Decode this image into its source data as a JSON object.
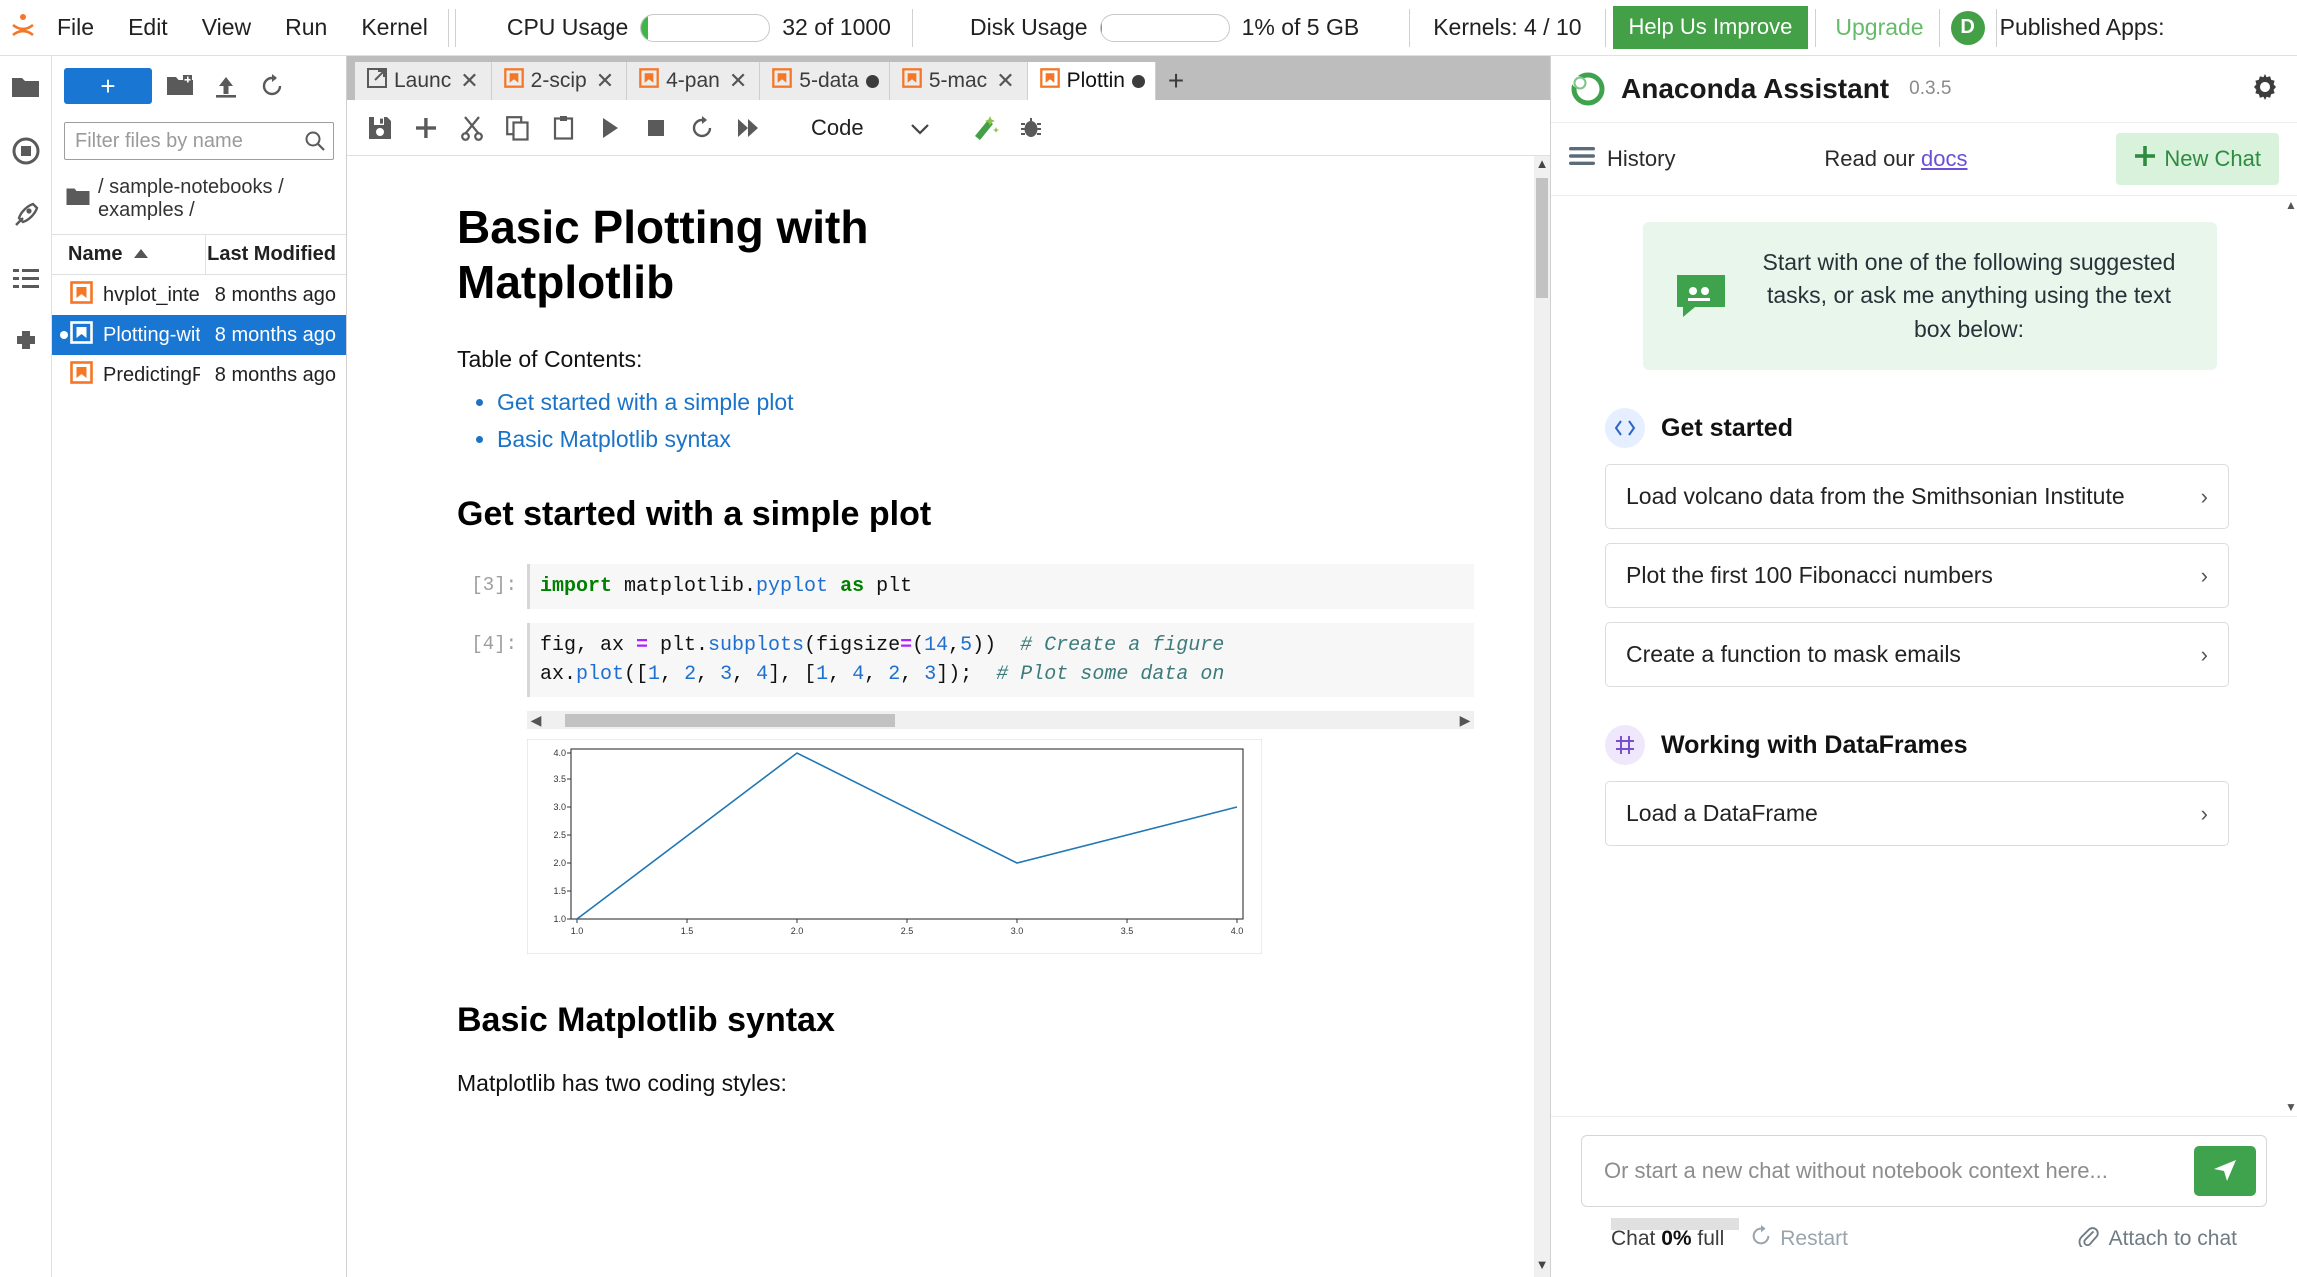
{
  "topbar": {
    "menus": [
      "File",
      "Edit",
      "View",
      "Run",
      "Kernel"
    ],
    "cpu_label": "CPU Usage",
    "cpu_value": "32 of 1000",
    "cpu_percent": 4,
    "disk_label": "Disk Usage",
    "disk_value": "1% of 5 GB",
    "disk_percent": 1,
    "kernels": "Kernels: 4 / 10",
    "help_button": "Help Us Improve",
    "upgrade": "Upgrade",
    "avatar": "D",
    "published_apps": "Published Apps:",
    "accent_green": "#43a047",
    "accent_blue": "#1976d2"
  },
  "filebrowser": {
    "new_label": "+",
    "filter_placeholder": "Filter files by name",
    "breadcrumb": "/ sample-notebooks / examples /",
    "columns": [
      "Name",
      "Last Modified"
    ],
    "rows": [
      {
        "name": "hvplot_inte...",
        "modified": "8 months ago",
        "selected": false,
        "running": false
      },
      {
        "name": "Plotting-wit...",
        "modified": "8 months ago",
        "selected": true,
        "running": true
      },
      {
        "name": "PredictingP...",
        "modified": "8 months ago",
        "selected": false,
        "running": false
      }
    ]
  },
  "notebook": {
    "tabs": [
      {
        "label": "Launc",
        "icon": "launcher-icon",
        "active": false,
        "dirty": false
      },
      {
        "label": "2-scip",
        "icon": "notebook-icon",
        "active": false,
        "dirty": false
      },
      {
        "label": "4-pan",
        "icon": "notebook-icon",
        "active": false,
        "dirty": false
      },
      {
        "label": "5-data",
        "icon": "notebook-icon",
        "active": false,
        "dirty": true
      },
      {
        "label": "5-mac",
        "icon": "notebook-icon",
        "active": false,
        "dirty": false
      },
      {
        "label": "Plottin",
        "icon": "notebook-icon",
        "active": true,
        "dirty": true
      }
    ],
    "add_tab_label": "+",
    "toolbar": {
      "cell_type": "Code",
      "icons": [
        "save-icon",
        "insert-cell-icon",
        "cut-icon",
        "copy-icon",
        "paste-icon",
        "run-icon",
        "stop-icon",
        "restart-icon",
        "restart-run-all-icon"
      ]
    },
    "title": "Basic Plotting with Matplotlib",
    "toc_label": "Table of Contents:",
    "toc": [
      "Get started with a simple plot",
      "Basic Matplotlib syntax"
    ],
    "section1_heading": "Get started with a simple plot",
    "section2_heading": "Basic Matplotlib syntax",
    "section2_text": "Matplotlib has two coding styles:",
    "cells": [
      {
        "prompt": "[3]:",
        "code_plain": "import matplotlib.pyplot as plt"
      },
      {
        "prompt": "[4]:",
        "code_plain": "fig, ax = plt.subplots(figsize=(14,5))  # Create a figure\nax.plot([1, 2, 3, 4], [1, 4, 2, 3]);  # Plot some data on"
      }
    ]
  },
  "chart_data": {
    "type": "line",
    "title": "",
    "xlabel": "",
    "ylabel": "",
    "x": [
      1,
      2,
      3,
      4
    ],
    "y": [
      1,
      4,
      2,
      3
    ],
    "xtick_labels": [
      "1.0",
      "1.5",
      "2.0",
      "2.5",
      "3.0",
      "3.5",
      "4.0"
    ],
    "xticks": [
      1.0,
      1.5,
      2.0,
      2.5,
      3.0,
      3.5,
      4.0
    ],
    "ytick_labels": [
      "1.0",
      "1.5",
      "2.0",
      "2.5",
      "3.0",
      "3.5",
      "4.0"
    ],
    "yticks": [
      1.0,
      1.5,
      2.0,
      2.5,
      3.0,
      3.5,
      4.0
    ],
    "xlim": [
      0.85,
      4.15
    ],
    "ylim": [
      0.85,
      4.15
    ],
    "grid": false,
    "line_color": "#1f77b4",
    "legend": null
  },
  "assistant": {
    "title": "Anaconda Assistant",
    "version": "0.3.5",
    "history_label": "History",
    "docs_prefix": "Read our",
    "docs_link": "docs",
    "new_chat": "New Chat",
    "suggest_banner": "Start with one of the following suggested tasks, or ask me anything using the text box below:",
    "sections": [
      {
        "title": "Get started",
        "icon": "code-icon",
        "items": [
          "Load volcano data from the Smithsonian Institute",
          "Plot the first 100 Fibonacci numbers",
          "Create a function to mask emails"
        ]
      },
      {
        "title": "Working with DataFrames",
        "icon": "table-icon",
        "items": [
          "Load a DataFrame"
        ]
      }
    ],
    "chat_placeholder": "Or start a new chat without notebook context here...",
    "chat_full_prefix": "Chat",
    "chat_full_value": "0%",
    "chat_full_suffix": "full",
    "restart_label": "Restart",
    "attach_label": "Attach to chat",
    "accent_green": "#3fa34d"
  }
}
